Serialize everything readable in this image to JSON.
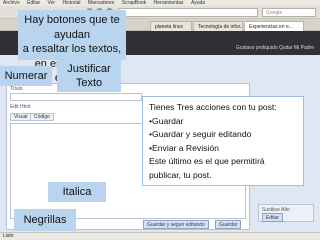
{
  "browser": {
    "menu": [
      "Archivo",
      "Editar",
      "Ver",
      "Historial",
      "Marcadores",
      "ScrapBook",
      "Herramientas",
      "Ayuda"
    ],
    "search_placeholder": "Google",
    "tabs": [
      "planeta linux",
      "Tecnología de infor...",
      "Experiencias en e..."
    ],
    "status_text": "Listo"
  },
  "blog": {
    "header_links": "Gustavo proliquido Quitar Mi Padre"
  },
  "editor": {
    "field_label": "Título",
    "edit_html_label": "Edit Html",
    "toolbar_buttons": [
      "Visual",
      "Código"
    ],
    "side_box_title": "Sustitue Alto",
    "side_box_button": "Editar",
    "save_continue_button": "Guardar y seguir editando",
    "publish_button": "Guardar"
  },
  "annotations": {
    "intro_lines": [
      "Hay botones que te ayudan",
      "a resaltar los textos,",
      "en este caso te explico"
    ],
    "numerar": "Numerar",
    "justificar": [
      "Justificar",
      "Texto"
    ],
    "actions_title": "Tienes Tres acciones con tu post:",
    "actions": [
      "•Guardar",
      "•Guardar y seguir editando",
      "•Enviar a Revisión"
    ],
    "actions_note": [
      "Este último es el que permitirá",
      "publicar, tu post."
    ],
    "italica": "Italica",
    "negrillas": "Negrillas"
  }
}
